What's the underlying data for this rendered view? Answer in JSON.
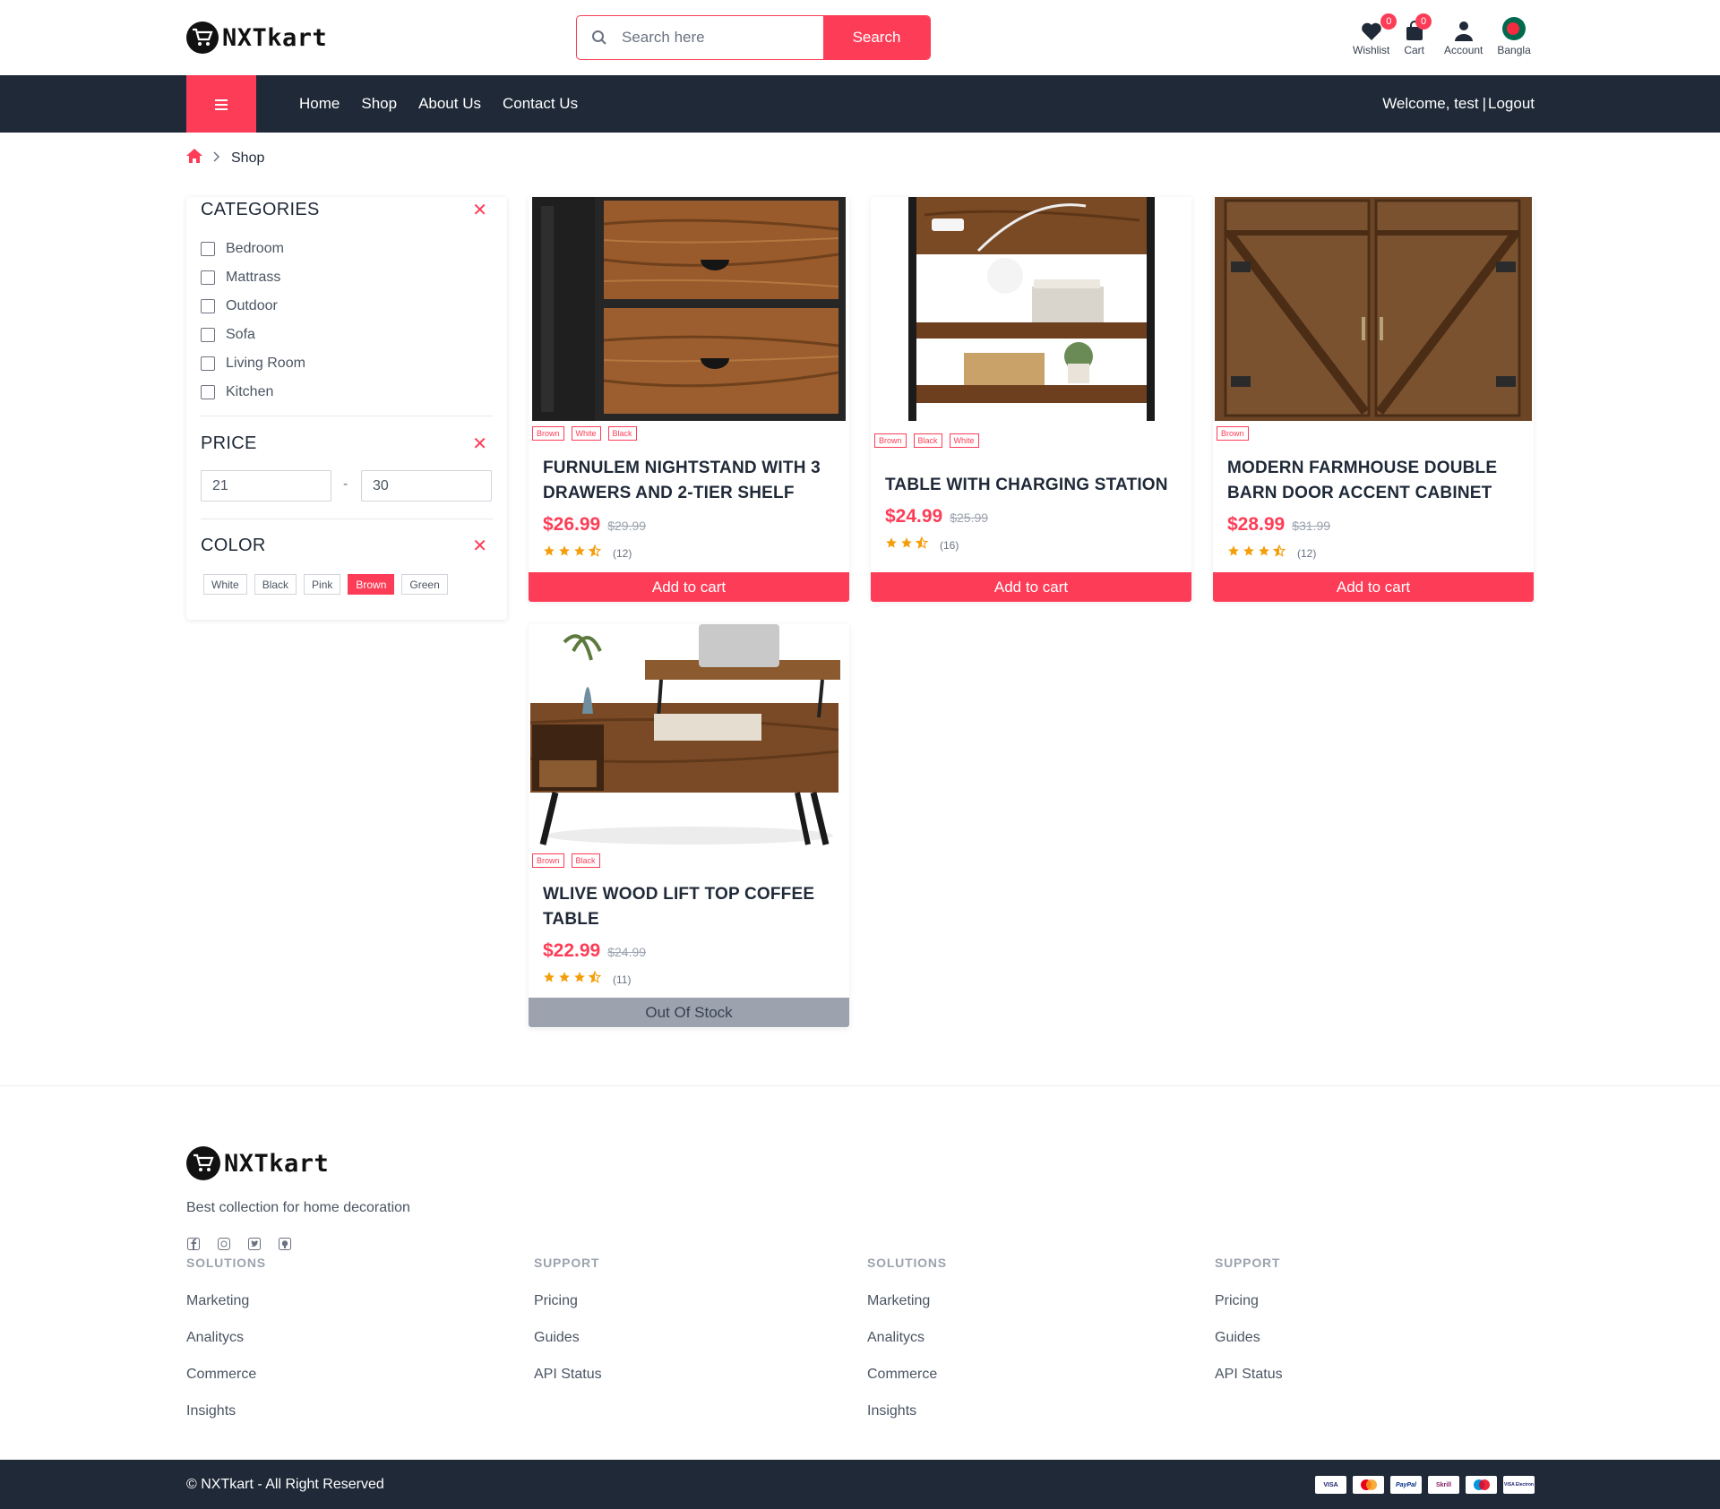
{
  "brand": {
    "name": "NXTkart"
  },
  "search": {
    "placeholder": "Search here",
    "button": "Search"
  },
  "top_icons": [
    {
      "label": "Wishlist",
      "badge": "0"
    },
    {
      "label": "Cart",
      "badge": "0"
    },
    {
      "label": "Account"
    },
    {
      "label": "Bangla"
    }
  ],
  "nav": {
    "links": [
      "Home",
      "Shop",
      "About Us",
      "Contact Us"
    ],
    "welcome": "Welcome, test",
    "separator": "|",
    "logout": "Logout"
  },
  "breadcrumb": {
    "current": "Shop"
  },
  "filters": {
    "categories_title": "Categories",
    "categories": [
      "Bedroom",
      "Mattrass",
      "Outdoor",
      "Sofa",
      "Living Room",
      "Kitchen"
    ],
    "price_title": "Price",
    "price_min": "21",
    "price_dash": "-",
    "price_max": "30",
    "color_title": "Color",
    "colors": [
      "White",
      "Black",
      "Pink",
      "Brown",
      "Green"
    ],
    "selected_color": "Brown"
  },
  "products": [
    {
      "tags": [
        "Brown",
        "White",
        "Black"
      ],
      "title": "Furnulem Nightstand with 3 Drawers and 2-Tier Shelf",
      "price": "$26.99",
      "old_price": "$29.99",
      "rating": 3.5,
      "reviews": "(12)",
      "button": "Add to cart",
      "in_stock": true
    },
    {
      "tags": [
        "Brown",
        "Black",
        "White"
      ],
      "title": "Table with Charging Station",
      "price": "$24.99",
      "old_price": "$25.99",
      "rating": 2.5,
      "reviews": "(16)",
      "button": "Add to cart",
      "in_stock": true
    },
    {
      "tags": [
        "Brown"
      ],
      "title": "Modern Farmhouse Double Barn Door Accent Cabinet",
      "price": "$28.99",
      "old_price": "$31.99",
      "rating": 3.5,
      "reviews": "(12)",
      "button": "Add to cart",
      "in_stock": true
    },
    {
      "tags": [
        "Brown",
        "Black"
      ],
      "title": "WLIVE Wood Lift Top Coffee Table",
      "price": "$22.99",
      "old_price": "$24.99",
      "rating": 3.5,
      "reviews": "(11)",
      "button": "Out Of Stock",
      "in_stock": false
    }
  ],
  "footer": {
    "tagline": "Best collection for home decoration",
    "social_icons": [
      "facebook-icon",
      "instagram-icon",
      "twitter-icon",
      "github-icon"
    ],
    "columns": [
      {
        "title": "Solutions",
        "links": [
          "Marketing",
          "Analitycs",
          "Commerce",
          "Insights"
        ]
      },
      {
        "title": "Support",
        "links": [
          "Pricing",
          "Guides",
          "API Status"
        ]
      },
      {
        "title": "Solutions",
        "links": [
          "Marketing",
          "Analitycs",
          "Commerce",
          "Insights"
        ]
      },
      {
        "title": "Support",
        "links": [
          "Pricing",
          "Guides",
          "API Status"
        ]
      }
    ],
    "copyright": "© NXTkart - All Right Reserved",
    "payments": [
      "VISA",
      "MC",
      "PayPal",
      "Skrill",
      "Maestro",
      "VISA Electron"
    ]
  },
  "colors": {
    "accent": "#fd3d57",
    "dark": "#1f2937",
    "star": "#f59e0b",
    "muted": "#9ca3af"
  }
}
